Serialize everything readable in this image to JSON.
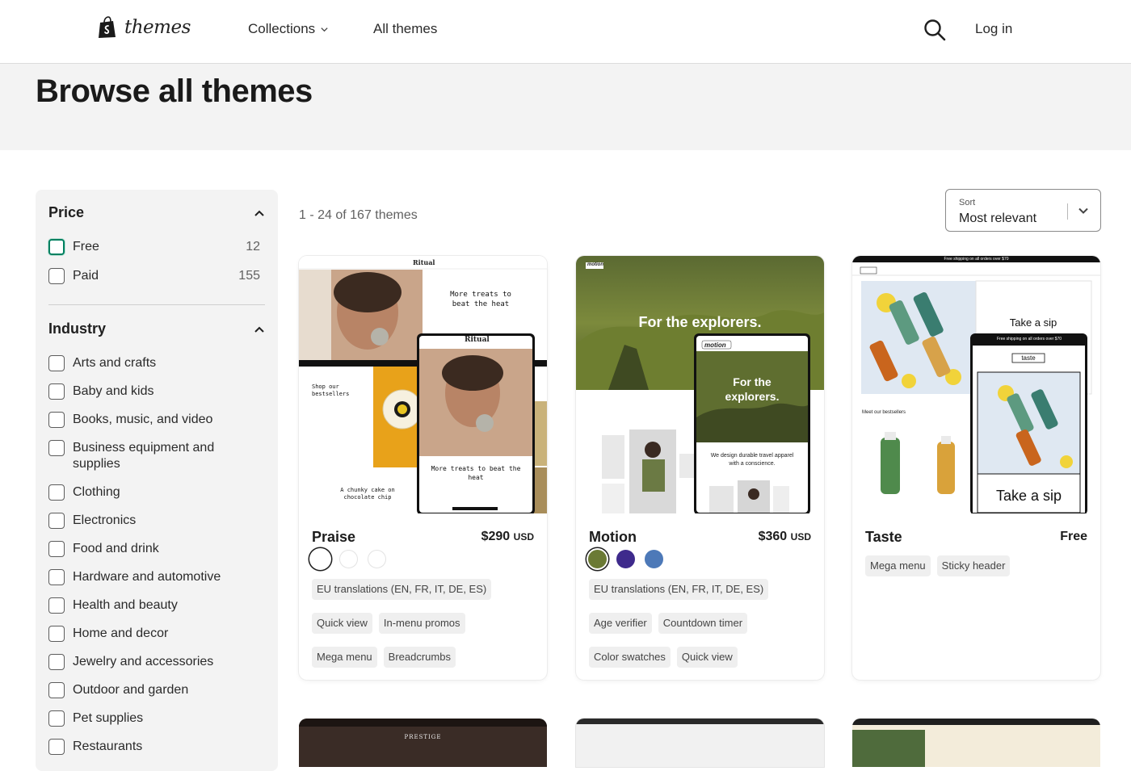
{
  "header": {
    "logo_text": "themes",
    "nav": {
      "collections": "Collections",
      "all_themes": "All themes"
    },
    "login": "Log in"
  },
  "hero": {
    "title": "Browse all themes"
  },
  "filters": {
    "price": {
      "title": "Price",
      "options": [
        {
          "label": "Free",
          "count": "12"
        },
        {
          "label": "Paid",
          "count": "155"
        }
      ]
    },
    "industry": {
      "title": "Industry",
      "options": [
        "Arts and crafts",
        "Baby and kids",
        "Books, music, and video",
        "Business equipment and supplies",
        "Clothing",
        "Electronics",
        "Food and drink",
        "Hardware and automotive",
        "Health and beauty",
        "Home and decor",
        "Jewelry and accessories",
        "Outdoor and garden",
        "Pet supplies",
        "Restaurants"
      ]
    }
  },
  "results": {
    "count_text": "1 - 24 of 167 themes",
    "sort": {
      "label": "Sort",
      "value": "Most relevant"
    }
  },
  "themes": [
    {
      "name": "Praise",
      "price": "$290",
      "currency": "USD",
      "swatches": [
        "#ffffff",
        "#ffffff",
        "#ffffff"
      ],
      "tags": [
        "EU translations (EN, FR, IT, DE, ES)",
        "Quick view",
        "In-menu promos",
        "Mega menu",
        "Breadcrumbs"
      ],
      "preview": {
        "brand": "Ritual",
        "headline": "More treats to beat the heat",
        "mobile_headline": "More treats to beat the heat",
        "bestsellers": "Shop our bestsellers",
        "cake": "A chunky cake on chocolate chip"
      }
    },
    {
      "name": "Motion",
      "price": "$360",
      "currency": "USD",
      "swatches": [
        "#6b7a35",
        "#3e2a8c",
        "#4d79b8"
      ],
      "tags": [
        "EU translations (EN, FR, IT, DE, ES)",
        "Age verifier",
        "Countdown timer",
        "Color swatches",
        "Quick view"
      ],
      "preview": {
        "brand": "motion",
        "headline": "For the explorers.",
        "mobile_headline": "For the explorers.",
        "sub": "We design durable travel apparel with a conscience."
      }
    },
    {
      "name": "Taste",
      "price": "Free",
      "currency": "",
      "swatches": [],
      "tags": [
        "Mega menu",
        "Sticky header"
      ],
      "preview": {
        "brand": "taste",
        "headline": "Take a sip",
        "mobile_headline": "Take a sip",
        "promo": "Free shipping on all orders over $70",
        "bestsellers": "Meet our bestsellers"
      }
    }
  ],
  "peek_cards": [
    {
      "brand": "PRESTIGE"
    },
    {
      "brand": ""
    },
    {
      "brand": ""
    }
  ]
}
